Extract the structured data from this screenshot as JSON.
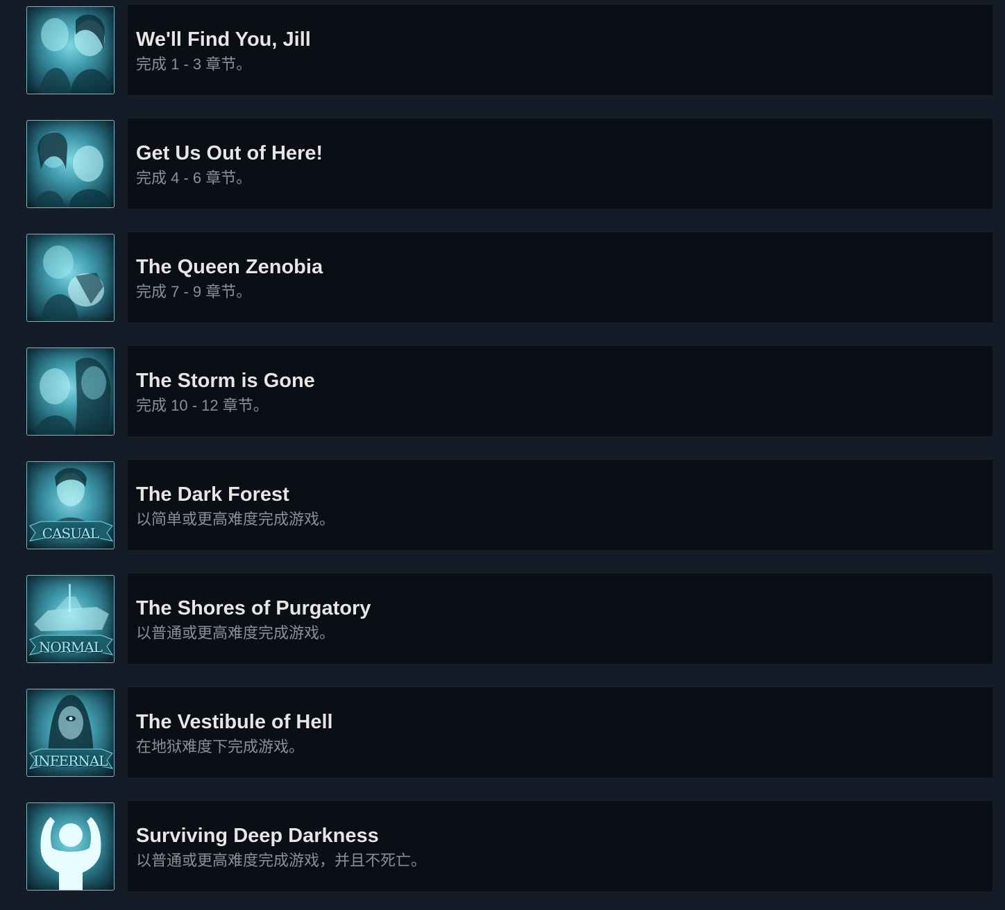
{
  "achievements": [
    {
      "title": "We'll Find You, Jill",
      "description": "完成 1 - 3 章节。",
      "icon": "jill-portrait-icon",
      "badge": ""
    },
    {
      "title": "Get Us Out of Here!",
      "description": "完成 4 - 6 章节。",
      "icon": "duo-portrait-icon",
      "badge": ""
    },
    {
      "title": "The Queen Zenobia",
      "description": "完成 7 - 9 章节。",
      "icon": "queen-zenobia-icon",
      "badge": ""
    },
    {
      "title": "The Storm is Gone",
      "description": "完成 10 - 12 章节。",
      "icon": "storm-portrait-icon",
      "badge": ""
    },
    {
      "title": "The Dark Forest",
      "description": "以简单或更高难度完成游戏。",
      "icon": "casual-difficulty-icon",
      "badge": "CASUAL"
    },
    {
      "title": "The Shores of Purgatory",
      "description": "以普通或更高难度完成游戏。",
      "icon": "normal-difficulty-icon",
      "badge": "NORMAL"
    },
    {
      "title": "The Vestibule of Hell",
      "description": "在地狱难度下完成游戏。",
      "icon": "infernal-difficulty-icon",
      "badge": "INFERNAL"
    },
    {
      "title": "Surviving Deep Darkness",
      "description": "以普通或更高难度完成游戏，并且不死亡。",
      "icon": "survivor-strong-icon",
      "badge": ""
    }
  ],
  "colors": {
    "background": "#141c27",
    "panel": "#0b0e15",
    "title": "#e6e6e6",
    "description": "#8c8f95",
    "icon_glow": "#7fd6e2"
  }
}
